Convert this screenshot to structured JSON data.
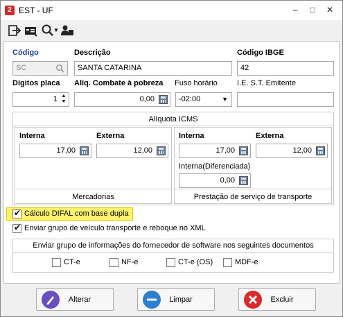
{
  "window": {
    "title": "EST - UF",
    "minimize": "–",
    "maximize": "□",
    "close": "✕"
  },
  "toolbar": {
    "icons": [
      "exit-icon",
      "record-card-icon",
      "search-icon",
      "users-icon"
    ]
  },
  "form": {
    "codigo": {
      "label": "Código",
      "value": "SC"
    },
    "descricao": {
      "label": "Descrição",
      "value": "SANTA CATARINA"
    },
    "codigo_ibge": {
      "label": "Código IBGE",
      "value": "42"
    },
    "digitos_placa": {
      "label": "Dígitos placa",
      "value": "1"
    },
    "aliq_pobreza": {
      "label": "Alíq. Combate à pobreza",
      "value": "0,00"
    },
    "fuso_horario": {
      "label": "Fuso horário",
      "value": "-02:00"
    },
    "ie_st": {
      "label": "I.E. S.T.  Emitente",
      "value": ""
    }
  },
  "aliquota_icms": {
    "title": "Alíquota ICMS",
    "mercadorias": {
      "title": "Mercadorias",
      "interna_label": "Interna",
      "interna": "17,00",
      "externa_label": "Externa",
      "externa": "12,00"
    },
    "transporte": {
      "title": "Prestação de serviço de transporte",
      "interna_label": "Interna",
      "interna": "17,00",
      "externa_label": "Externa",
      "externa": "12,00",
      "diferenciada_label": "Interna(Diferenciada)",
      "diferenciada": "0,00"
    }
  },
  "options": {
    "difal": {
      "label": "Cálculo DIFAL com base dupla",
      "checked": true
    },
    "veiculo": {
      "label": "Enviar grupo de veículo transporte e reboque no XML",
      "checked": true
    }
  },
  "fornecedor": {
    "title": "Enviar grupo de informações do fornecedor de software nos seguintes documentos",
    "docs": [
      {
        "label": "CT-e",
        "checked": false
      },
      {
        "label": "NF-e",
        "checked": false
      },
      {
        "label": "CT-e (OS)",
        "checked": false
      },
      {
        "label": "MDF-e",
        "checked": false
      }
    ]
  },
  "buttons": {
    "alterar": "Alterar",
    "limpar": "Limpar",
    "excluir": "Excluir"
  },
  "colors": {
    "accent_blue": "#1a3ea8",
    "highlight": "#fff36b",
    "btn_alterar": "#6a4fc0",
    "btn_limpar": "#2f7fd1",
    "btn_excluir": "#d92b2b"
  }
}
